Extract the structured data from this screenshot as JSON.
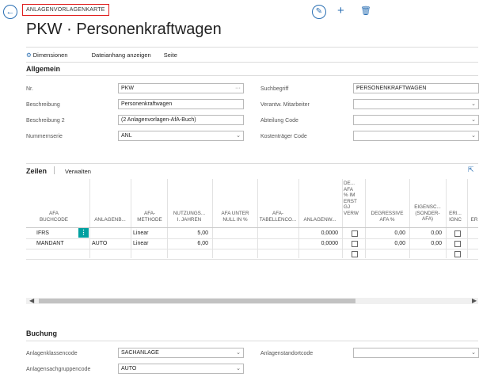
{
  "header": {
    "breadcrumb": "ANLAGENVORLAGENKARTE",
    "title": "PKW · Personenkraftwagen"
  },
  "actions": [
    "Dimensionen",
    "Dateianhang anzeigen",
    "Seite"
  ],
  "allgemein": {
    "heading": "Allgemein",
    "nr_label": "Nr.",
    "nr_value": "PKW",
    "beschreibung_label": "Beschreibung",
    "beschreibung_value": "Personenkraftwagen",
    "beschreibung2_label": "Beschreibung 2",
    "beschreibung2_value": "(2 Anlagenvorlagen-AfA-Buch)",
    "nummernserie_label": "Nummernserie",
    "nummernserie_value": "ANL",
    "suchbegriff_label": "Suchbegriff",
    "suchbegriff_value": "PERSONENKRAFTWAGEN",
    "verantw_label": "Verantw. Mitarbeiter",
    "abteilung_label": "Abteilung Code",
    "kostentraeger_label": "Kostenträger Code"
  },
  "zeilen": {
    "heading": "Zeilen",
    "verwalten": "Verwalten",
    "columns": {
      "afa_buchcode": [
        "AFA",
        "BUCHCODE"
      ],
      "anlagenb": [
        "ANLAGENB..."
      ],
      "afa_methode": [
        "AFA-",
        "METHODE"
      ],
      "nutzungs": [
        "NUTZUNGS...",
        "I. JAHREN"
      ],
      "afa_unter": [
        "AFA UNTER",
        "NULL IN %"
      ],
      "afa_tabellen": [
        "AFA-",
        "TABELLENCO..."
      ],
      "anlagenw": [
        "ANLAGENW..."
      ],
      "de_afa": [
        "DE...",
        "AFA",
        "% IM",
        "ERST",
        "GJ",
        "VERW"
      ],
      "degressive": [
        "DEGRESSIVE",
        "AFA %"
      ],
      "eigensc": [
        "EIGENSC...",
        "(SONDER-",
        "AFA)"
      ],
      "eri": [
        "ERI...",
        "IGNC"
      ],
      "er": [
        "ER"
      ]
    },
    "rows": [
      {
        "buchcode": "IFRS",
        "anlagenb": "",
        "methode": "Linear",
        "nutzung": "5,00",
        "anlagenw": "0,0000",
        "degressive": "0,00",
        "eigensc": "0,00"
      },
      {
        "buchcode": "MANDANT",
        "anlagenb": "AUTO",
        "methode": "Linear",
        "nutzung": "6,00",
        "anlagenw": "0,0000",
        "degressive": "0,00",
        "eigensc": "0,00"
      }
    ]
  },
  "buchung": {
    "heading": "Buchung",
    "klassen_label": "Anlagenklassencode",
    "klassen_value": "SACHANLAGE",
    "sachgruppen_label": "Anlagensachgruppencode",
    "sachgruppen_value": "AUTO",
    "standort_label": "Anlagenstandortcode"
  },
  "colors": {
    "accent": "#2a6fb3",
    "highlight": "#e02020",
    "selected_cell": "#00a0a0"
  }
}
